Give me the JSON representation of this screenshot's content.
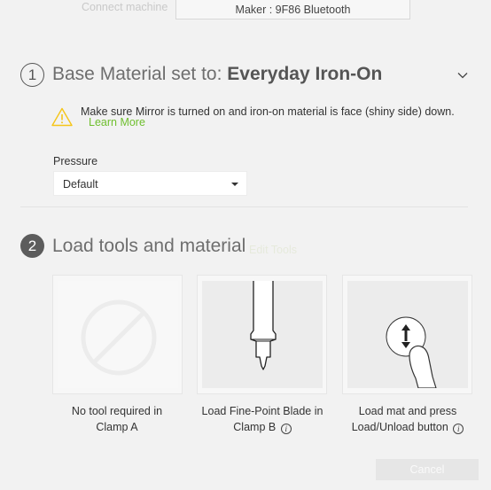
{
  "connect": {
    "label": "Connect machine",
    "machine": "Maker : 9F86 Bluetooth"
  },
  "step1": {
    "number": "1",
    "title_prefix": "Base Material set to: ",
    "material": "Everyday Iron-On",
    "warning": "Make sure Mirror is turned on and iron-on material is face (shiny side) down.",
    "learn_more": "Learn More",
    "pressure_label": "Pressure",
    "pressure_value": "Default"
  },
  "step2": {
    "number": "2",
    "title": "Load tools and material",
    "edit_tools": "Edit Tools",
    "cards": [
      {
        "caption_line1": "No tool required in",
        "caption_line2": "Clamp A"
      },
      {
        "caption_line1": "Load Fine-Point Blade in",
        "caption_line2": "Clamp B"
      },
      {
        "caption_line1": "Load mat and press",
        "caption_line2": "Load/Unload button"
      }
    ],
    "info_glyph": "i"
  },
  "footer": {
    "cancel": "Cancel"
  },
  "colors": {
    "accent_green": "#6fbf2e",
    "warning_yellow": "#f5c518",
    "step_filled": "#5c5c5c"
  }
}
